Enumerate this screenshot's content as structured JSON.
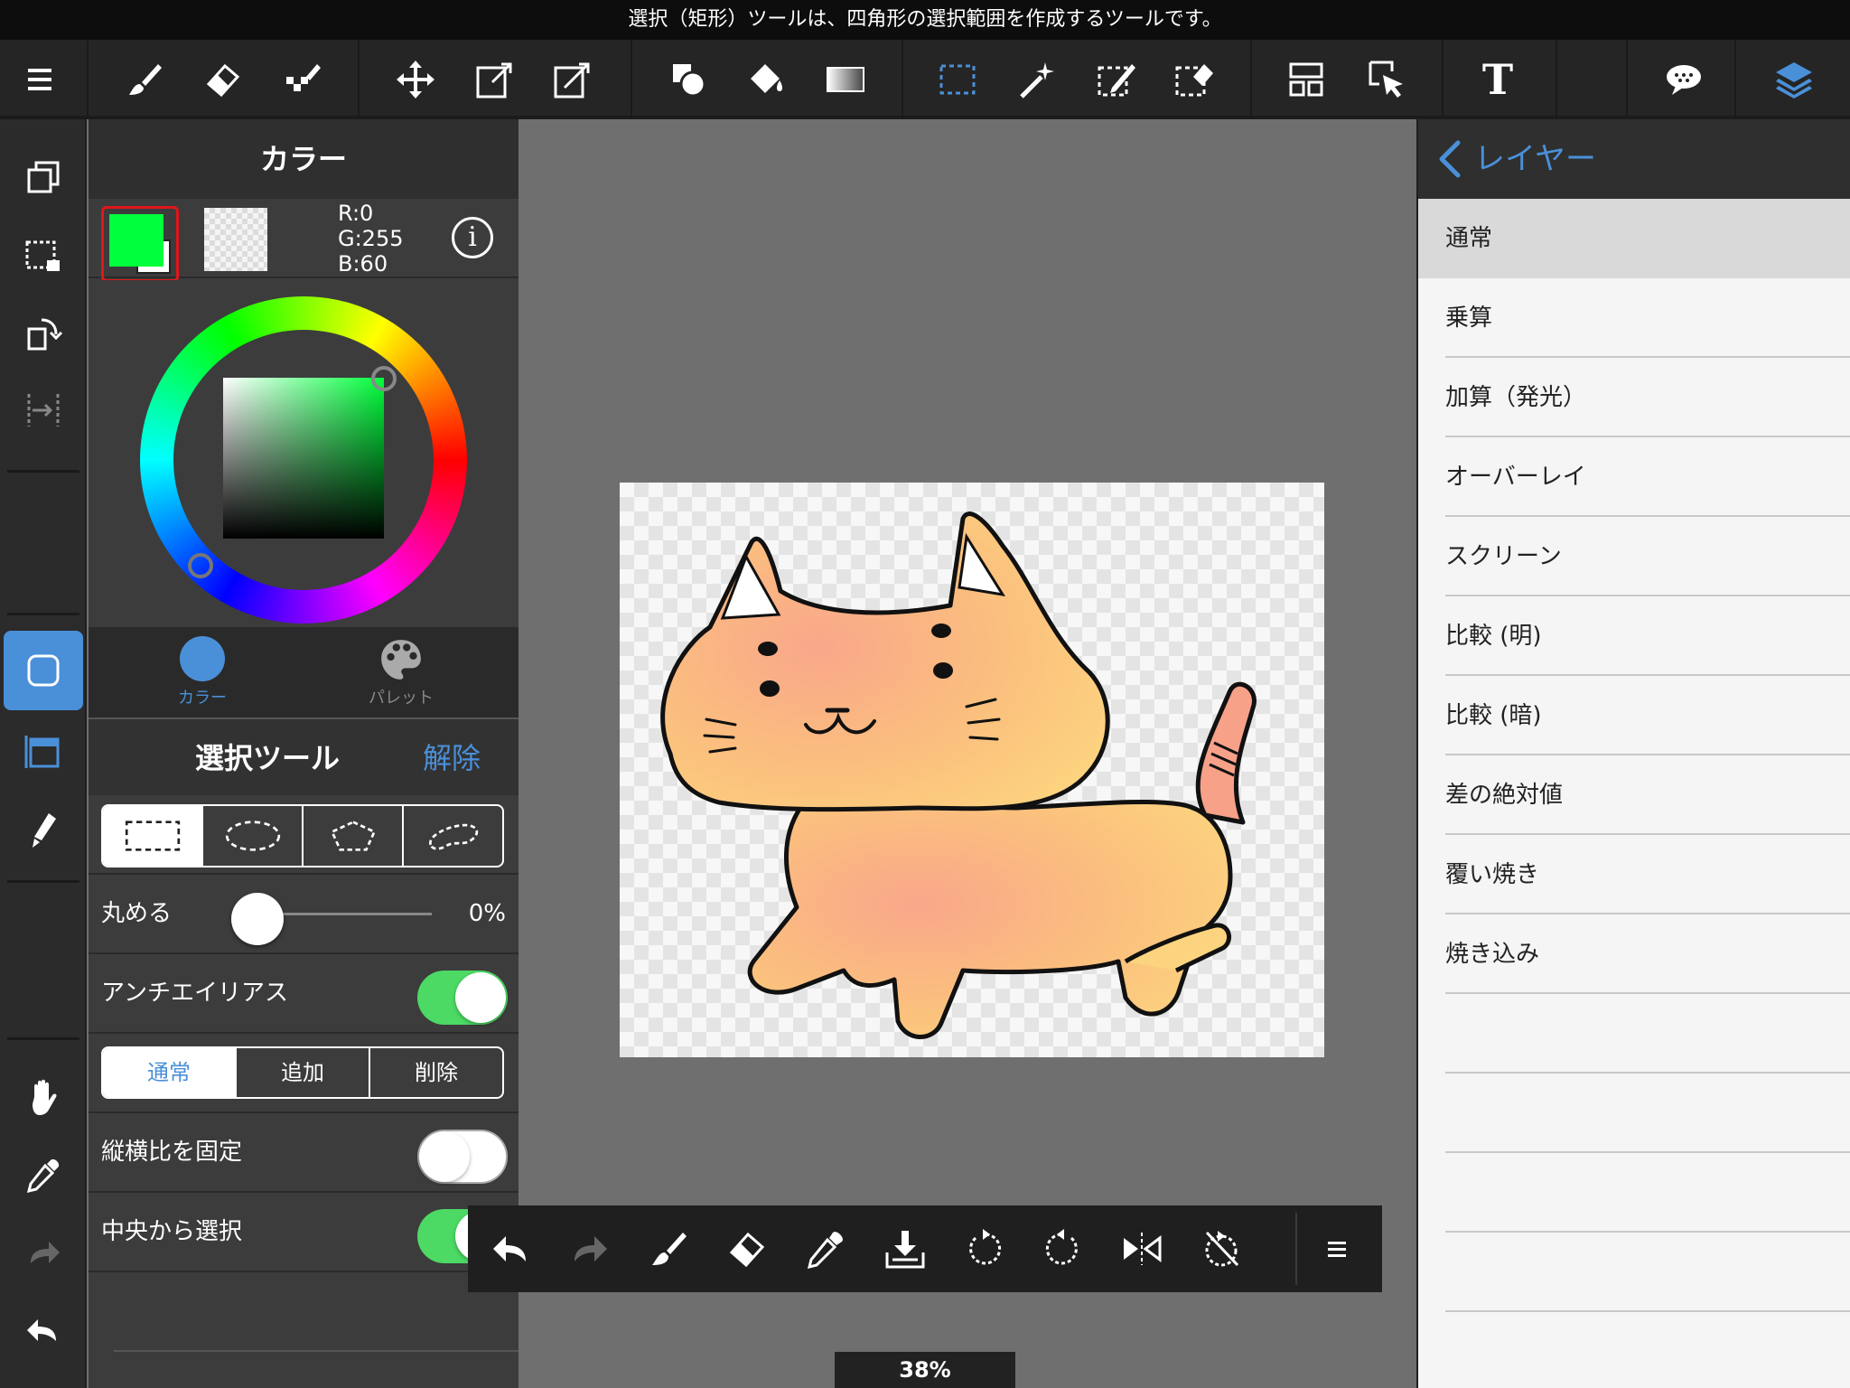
{
  "tooltip": "選択（矩形）ツールは、四角形の選択範囲を作成するツールです。",
  "toolbar": {
    "icons": [
      "menu-icon",
      "brush-icon",
      "eraser-icon",
      "dot-tool-icon",
      "move-icon",
      "transform-icon",
      "mesh-transform-icon",
      "shape-fill-icon",
      "bucket-icon",
      "gradient-icon",
      "rect-select-icon",
      "magic-wand-icon",
      "select-pen-icon",
      "select-eraser-icon",
      "layer-layout-icon",
      "operation-icon",
      "text-icon",
      "speech-bubble-icon",
      "layers-icon"
    ],
    "text_glyph": "T",
    "layers_color": "#4a90d9",
    "select_color": "#4a90d9"
  },
  "left_column": {
    "icons": [
      "duplicate-layer-icon",
      "select-layer-icon",
      "rotate-canvas-icon",
      "snap-icon",
      "brush-size-icon",
      "frame-icon",
      "pen-icon",
      "hand-icon",
      "eyedropper-icon",
      "redo-icon",
      "undo-icon"
    ]
  },
  "color_panel": {
    "title": "カラー",
    "rgb": {
      "r": "R:0",
      "g": "G:255",
      "b": "B:60"
    },
    "info_glyph": "i",
    "primary_color": "#00ff3c",
    "secondary_color": "#ffffff",
    "tabs": [
      {
        "label": "カラー",
        "active": true
      },
      {
        "label": "パレット",
        "active": false
      }
    ]
  },
  "selection_panel": {
    "title": "選択ツール",
    "clear_label": "解除",
    "shapes": [
      "rectangle",
      "ellipse",
      "polygon",
      "lasso"
    ],
    "round_label": "丸める",
    "round_value": "0%",
    "round_fraction": 0,
    "antialias_label": "アンチエイリアス",
    "antialias_on": true,
    "modes": [
      "通常",
      "追加",
      "削除"
    ],
    "mode_selected": "通常",
    "fixed_ratio_label": "縦横比を固定",
    "fixed_ratio_on": false,
    "from_center_label": "中央から選択",
    "from_center_on": true
  },
  "bottom_bar": {
    "icons": [
      "undo-icon",
      "redo-icon",
      "brush-icon",
      "eraser-icon",
      "eyedropper-icon",
      "save-icon",
      "rotate-left-icon",
      "rotate-right-icon",
      "flip-icon",
      "rotate-reset-icon",
      "more-menu-icon"
    ]
  },
  "zoom_label": "38%",
  "layer_panel": {
    "back_label": "レイヤー",
    "blend_modes": [
      "通常",
      "乗算",
      "加算（発光）",
      "オーバーレイ",
      "スクリーン",
      "比較 (明)",
      "比較 (暗)",
      "差の絶対値",
      "覆い焼き",
      "焼き込み"
    ],
    "selected": "通常"
  }
}
